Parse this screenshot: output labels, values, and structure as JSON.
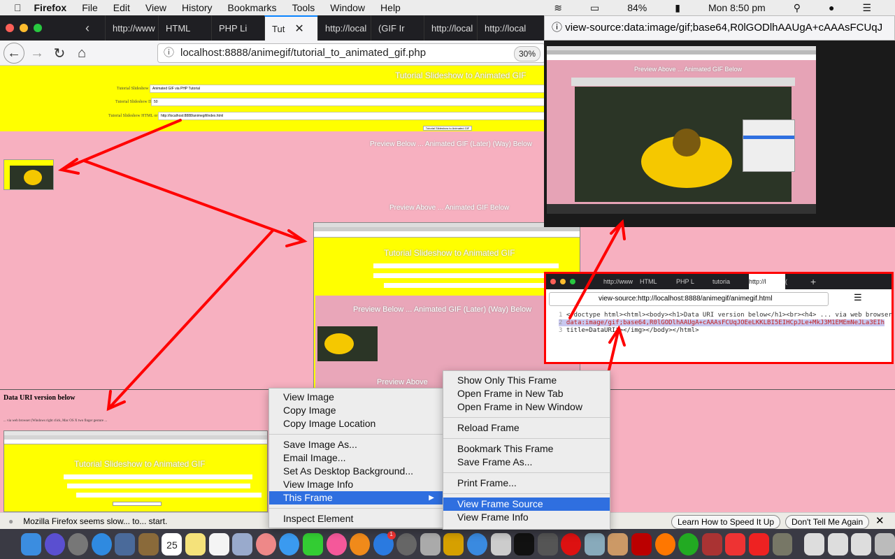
{
  "menubar": {
    "app": "Firefox",
    "items": [
      "File",
      "Edit",
      "View",
      "History",
      "Bookmarks",
      "Tools",
      "Window",
      "Help"
    ],
    "battery": "84%",
    "clock": "Mon 8:50 pm"
  },
  "tabs": [
    {
      "label": "http://www"
    },
    {
      "label": "HTML"
    },
    {
      "label": "PHP Li"
    },
    {
      "label": "Tut",
      "active": true
    },
    {
      "label": "http://local"
    },
    {
      "label": "(GIF Ir"
    },
    {
      "label": "http://local"
    },
    {
      "label": "http://local"
    }
  ],
  "navbar": {
    "url": "localhost:8888/animegif/tutorial_to_animated_gif.php",
    "zoom": "30%"
  },
  "page": {
    "title": "Tutorial Slideshow to Animated GIF",
    "fields": [
      {
        "label": "Tutorial Slideshow Title",
        "value": "Animated GIF via PHP Tutorial"
      },
      {
        "label": "Tutorial Slideshow Delay",
        "value": "50"
      },
      {
        "label": "Tutorial Slideshow HTML or Image",
        "value": "http://localhost:8888/animegif/index.html"
      }
    ],
    "submit": "Tutorial Slideshow to Animated GIF",
    "preview_below": "Preview Below ... Animated GIF (Later) (Way) Below",
    "preview_above": "Preview Above ... Animated GIF Below",
    "preview_above_short": "Preview Above",
    "data_uri_heading": "Data URI version below",
    "data_uri_note": "... via web browser (Windows right click, Mac OS X two finger gesture ..."
  },
  "viewsource_top": {
    "url": "view-source:data:image/gif;base64,R0lGODlhAAUgA+cAAAsFCUqJ"
  },
  "viewsource_box": {
    "tabs": [
      "http://www",
      "HTML",
      "PHP L",
      "tutoria",
      "http://l",
      "("
    ],
    "url": "view-source:http://localhost:8888/animegif/animegif.html",
    "lines": [
      {
        "n": "1",
        "text": "<!doctype html><html><body><h1>Data URI version below</h1><br><h4> ... via web browser"
      },
      {
        "n": "2",
        "text": "data:image/gif;base64,R0lGODlhAAUgA+cAAAsFCUqJOEeLKKLBI5EIHCpJLe+MkJ3M1EMEmNeJLa3EIh"
      },
      {
        "n": "3",
        "text": " title=DataURI\"></img></body></html>"
      }
    ],
    "accent": "#ff0000"
  },
  "context_menu": {
    "items": [
      "View Image",
      "Copy Image",
      "Copy Image Location",
      "Save Image As...",
      "Email Image...",
      "Set As Desktop Background...",
      "View Image Info",
      "This Frame",
      "Inspect Element"
    ],
    "highlighted": "This Frame"
  },
  "submenu": {
    "items": [
      "Show Only This Frame",
      "Open Frame in New Tab",
      "Open Frame in New Window",
      "Reload Frame",
      "Bookmark This Frame",
      "Save Frame As...",
      "Print Frame...",
      "View Frame Source",
      "View Frame Info"
    ],
    "highlighted": "View Frame Source"
  },
  "notification": {
    "text": "Mozilla Firefox seems slow... to... start.",
    "learn": "Learn How to Speed It Up",
    "dismiss": "Don't Tell Me Again"
  },
  "dock": {
    "calendar_day": "25",
    "badge": "1"
  },
  "colors": {
    "yellow": "#ffff00",
    "pink": "#f7b0c0",
    "arrow": "#ff0000",
    "highlight": "#2f6fe0"
  }
}
